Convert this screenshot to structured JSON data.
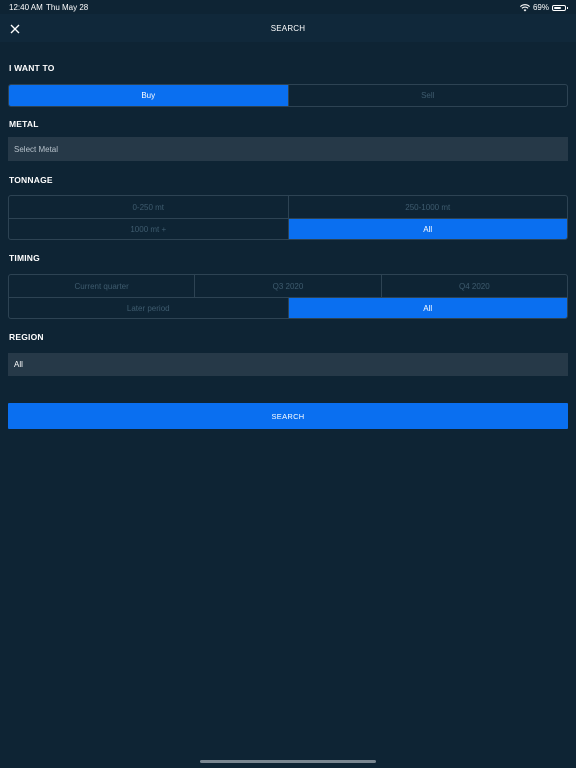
{
  "status_bar": {
    "time": "12:40 AM",
    "date": "Thu May 28",
    "battery_percent": "69%",
    "battery_level": 0.69
  },
  "header": {
    "title": "SEARCH"
  },
  "intent": {
    "label": "I WANT TO",
    "options": [
      "Buy",
      "Sell"
    ],
    "selected": "Buy"
  },
  "metal": {
    "label": "METAL",
    "placeholder": "Select Metal"
  },
  "tonnage": {
    "label": "TONNAGE",
    "options": [
      "0-250 mt",
      "250-1000 mt",
      "1000 mt +",
      "All"
    ],
    "selected": "All"
  },
  "timing": {
    "label": "TIMING",
    "options": [
      "Current quarter",
      "Q3 2020",
      "Q4 2020",
      "Later period",
      "All"
    ],
    "selected": "All"
  },
  "region": {
    "label": "REGION",
    "value": "All"
  },
  "search_button": {
    "label": "SEARCH"
  },
  "colors": {
    "background": "#0e2434",
    "accent": "#0a6ff0",
    "field": "#263948",
    "border": "#2d4353"
  }
}
